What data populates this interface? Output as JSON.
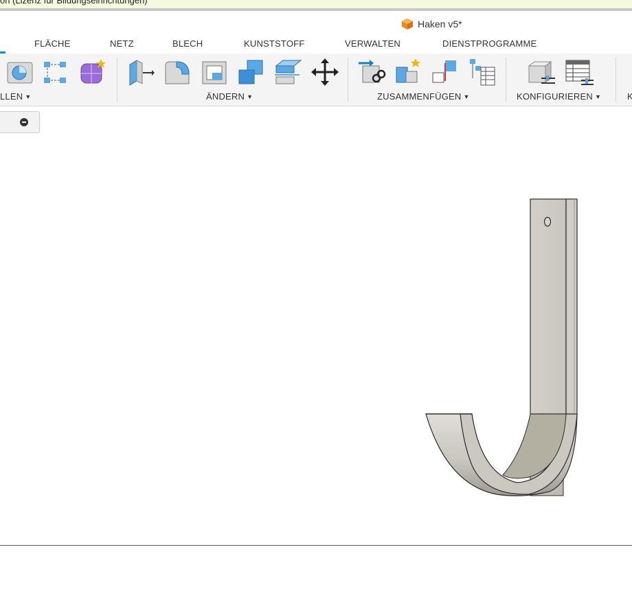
{
  "license_bar": {
    "text": "on (Lizenz für Bildungseinrichtungen)"
  },
  "document": {
    "title": "Haken v5*",
    "icon": "document-cube-icon"
  },
  "tabs": [
    "FLÄCHE",
    "NETZ",
    "BLECH",
    "KUNSTSTOFF",
    "VERWALTEN",
    "DIENSTPROGRAMME"
  ],
  "groups": {
    "create": "LLEN",
    "modify": "ÄNDERN",
    "assemble": "ZUSAMMENFÜGEN",
    "configure": "KONFIGURIEREN",
    "next": "K"
  },
  "tools": {
    "create": [
      "revolve-icon",
      "sketch-pattern-icon",
      "create-form-icon"
    ],
    "modify": [
      "press-pull-icon",
      "fillet-icon",
      "shell-icon",
      "combine-icon",
      "offset-face-icon",
      "move-icon"
    ],
    "assemble": [
      "new-component-icon",
      "joint-icon",
      "as-built-joint-icon",
      "joint-table-icon"
    ],
    "configure": [
      "configure-parameter-icon",
      "configuration-table-icon"
    ]
  },
  "colors": {
    "accent": "#0696d7",
    "icon_blue": "#5aa9e6",
    "purple": "#9b6cd8",
    "model_face": "#c9c7be",
    "model_edge": "#2b2b2b"
  }
}
